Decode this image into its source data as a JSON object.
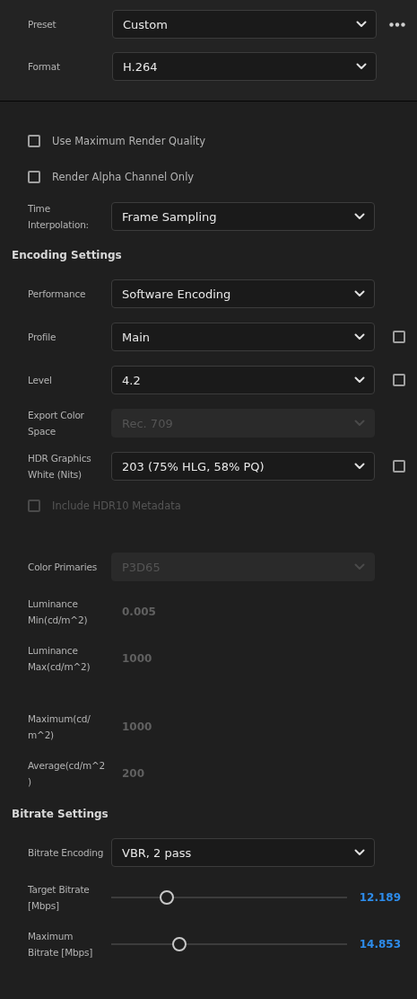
{
  "header": {
    "rows": [
      {
        "label": "Preset",
        "value": "Custom",
        "more": true
      },
      {
        "label": "Format",
        "value": "H.264",
        "more": false
      }
    ]
  },
  "rows": [
    {
      "kind": "spacer"
    },
    {
      "kind": "checkbox",
      "label": "Use Maximum Render Quality",
      "checked": false,
      "disabled": false
    },
    {
      "kind": "checkbox",
      "label": "Render Alpha Channel Only",
      "checked": false,
      "disabled": false
    },
    {
      "kind": "dropdown",
      "label": "Time Interpolation:",
      "value": "Frame Sampling",
      "disabled": false
    },
    {
      "kind": "section",
      "label": "Encoding Settings"
    },
    {
      "kind": "dropdown",
      "label": "Performance",
      "value": "Software Encoding",
      "disabled": false
    },
    {
      "kind": "dropdown",
      "label": "Profile",
      "value": "Main",
      "disabled": false,
      "side_checked": false
    },
    {
      "kind": "dropdown",
      "label": "Level",
      "value": "4.2",
      "disabled": false,
      "side_checked": false
    },
    {
      "kind": "dropdown",
      "label": "Export Color Space",
      "value": "Rec. 709",
      "disabled": true
    },
    {
      "kind": "dropdown",
      "label": "HDR Graphics White (Nits)",
      "value": "203 (75% HLG, 58% PQ)",
      "disabled": false,
      "side_checked": false
    },
    {
      "kind": "checkbox",
      "label": "Include HDR10 Metadata",
      "checked": false,
      "disabled": true
    },
    {
      "kind": "spacer"
    },
    {
      "kind": "dropdown",
      "label": "Color Primaries",
      "value": "P3D65",
      "disabled": true
    },
    {
      "kind": "value",
      "label": "Luminance Min(cd/m^2)",
      "value": "0.005"
    },
    {
      "kind": "value",
      "label": "Luminance Max(cd/m^2)",
      "value": "1000"
    },
    {
      "kind": "spacer"
    },
    {
      "kind": "value",
      "label": "Maximum(cd/ m^2)",
      "value": "1000"
    },
    {
      "kind": "value",
      "label": "Average(cd/m^2)",
      "value": "200"
    },
    {
      "kind": "section",
      "label": "Bitrate Settings"
    },
    {
      "kind": "dropdown",
      "label": "Bitrate Encoding",
      "value": "VBR, 2 pass",
      "disabled": false
    },
    {
      "kind": "slider",
      "label": "Target Bitrate [Mbps]",
      "level": 0.236,
      "reading": "12.189"
    },
    {
      "kind": "slider",
      "label": "Maximum Bitrate [Mbps]",
      "level": 0.29,
      "reading": "14.853"
    }
  ]
}
